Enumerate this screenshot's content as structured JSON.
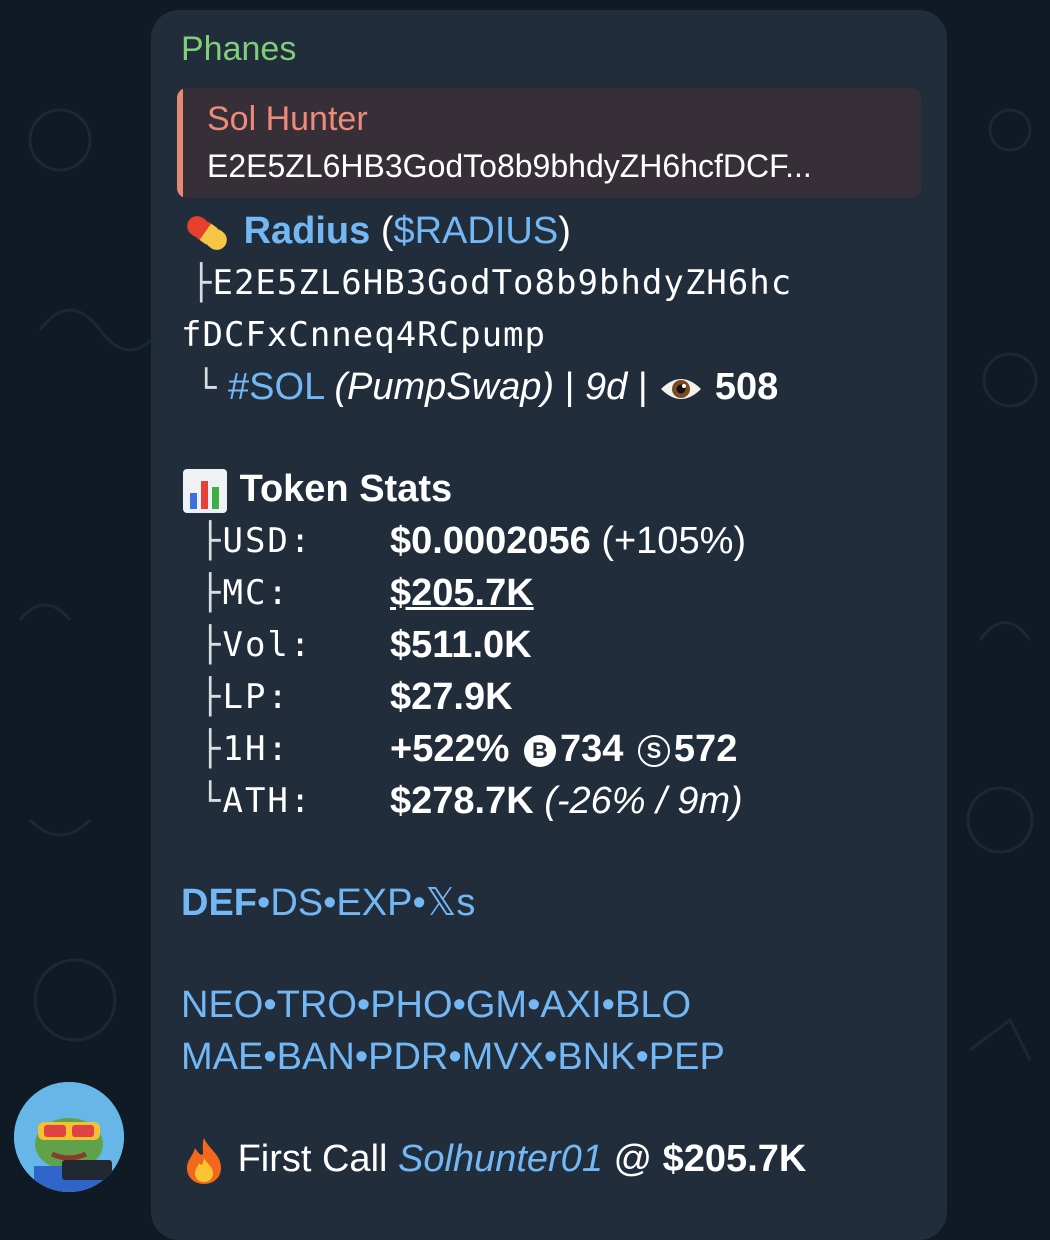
{
  "message": {
    "sender": "Phanes",
    "reply": {
      "name": "Sol Hunter",
      "text": "E2E5ZL6HB3GodTo8b9bhdyZH6hcfDCF..."
    },
    "token": {
      "name": "Radius",
      "ticker": "$RADIUS",
      "address_line1": "E2E5ZL6HB3GodTo8b9bhdyZH6hc",
      "address_line2": "fDCFxCnneq4RCpump",
      "chain_tag": "#SOL",
      "dex": "(PumpSwap)",
      "age": "9d",
      "views": "508",
      "tree_mid": "├",
      "tree_end": "└"
    },
    "stats": {
      "heading": "Token Stats",
      "rows": [
        {
          "label": "USD:",
          "value": "$0.0002056",
          "extra": "(+105%)"
        },
        {
          "label": "MC:",
          "value": "$205.7K"
        },
        {
          "label": "Vol:",
          "value": "$511.0K"
        },
        {
          "label": "LP:",
          "value": "$27.9K"
        },
        {
          "label": "1H:",
          "value": "+522%",
          "buys_symbol": "B",
          "buys": "734",
          "sells_symbol": "S",
          "sells": "572"
        },
        {
          "label": "ATH:",
          "value": "$278.7K",
          "extra": "(-26% / 9m)"
        }
      ]
    },
    "links1": [
      "DEF",
      "DS",
      "EXP",
      "𝕏s"
    ],
    "links2": [
      "NEO",
      "TRO",
      "PHO",
      "GM",
      "AXI",
      "BLO"
    ],
    "links3": [
      "MAE",
      "BAN",
      "PDR",
      "MVX",
      "BNK",
      "PEP"
    ],
    "separator": "•",
    "first_call": {
      "label": "First Call",
      "user": "Solhunter01",
      "at": "@",
      "price": "$205.7K"
    }
  },
  "colors": {
    "background": "#0f1a24",
    "bubble": "#212d3b",
    "sender": "#7fcf78",
    "reply_accent": "#e78876",
    "link": "#73b8f5"
  },
  "icons": [
    "pill-icon",
    "eye-icon",
    "bar-chart-icon",
    "fire-icon",
    "avatar"
  ]
}
